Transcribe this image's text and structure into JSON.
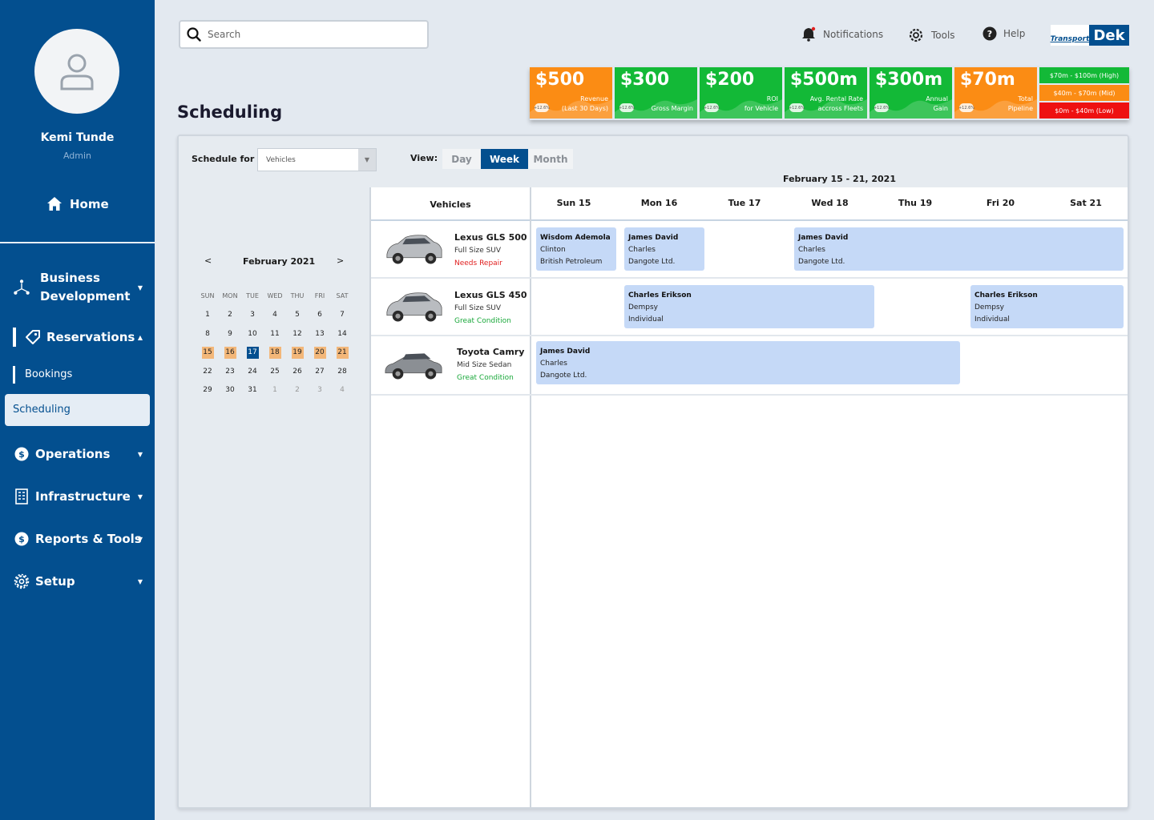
{
  "user": {
    "name": "Kemi Tunde",
    "role": "Admin"
  },
  "sidebar": {
    "home": "Home",
    "business_dev": [
      "Business",
      "Development"
    ],
    "reservations": "Reservations",
    "bookings": "Bookings",
    "scheduling": "Scheduling",
    "operations": "Operations",
    "infrastructure": "Infrastructure",
    "reports": "Reports & Tools",
    "setup": "Setup"
  },
  "topbar": {
    "search_placeholder": "Search",
    "notifications": "Notifications",
    "tools": "Tools",
    "help": "Help",
    "logo_left": "Transport",
    "logo_right": "Dek"
  },
  "page_title": "Scheduling",
  "kpis": [
    {
      "value": "$500",
      "label1": "Revenue",
      "label2": "(Last 30 Days)",
      "chip": "+12.6%",
      "color": "#fb8c14"
    },
    {
      "value": "$300",
      "label1": "",
      "label2": "Gross Margin",
      "chip": "+12.6%",
      "color": "#13b937"
    },
    {
      "value": "$200",
      "label1": "ROI",
      "label2": "for Vehicle",
      "chip": "+12.6%",
      "color": "#13b937"
    },
    {
      "value": "$500m",
      "label1": "Avg. Rental Rate",
      "label2": "accross Fleets",
      "chip": "+12.6%",
      "color": "#13b937"
    },
    {
      "value": "$300m",
      "label1": "Annual",
      "label2": "Gain",
      "chip": "+12.6%",
      "color": "#13b937"
    },
    {
      "value": "$70m",
      "label1": "Total",
      "label2": "Pipeline",
      "chip": "+12.6%",
      "color": "#fb8c14"
    }
  ],
  "pipeline": [
    {
      "text": "$70m - $100m (High)",
      "color": "#13b937"
    },
    {
      "text": "$40m - $70m (Mid)",
      "color": "#fb8c14"
    },
    {
      "text": "$0m - $40m (Low)",
      "color": "#ee1111"
    }
  ],
  "schedule": {
    "schedule_for_label": "Schedule for",
    "schedule_for_value": "Vehicles",
    "view_label": "View:",
    "views": [
      "Day",
      "Week",
      "Month"
    ],
    "active_view": "Week",
    "range": "February 15 - 21, 2021"
  },
  "mini_calendar": {
    "prev": "<",
    "next": ">",
    "title": "February 2021",
    "dow": [
      "SUN",
      "MON",
      "TUE",
      "WED",
      "THU",
      "FRI",
      "SAT"
    ],
    "weeks": [
      [
        "1",
        "2",
        "3",
        "4",
        "5",
        "6",
        "7"
      ],
      [
        "8",
        "9",
        "10",
        "11",
        "12",
        "13",
        "14"
      ],
      [
        "15",
        "16",
        "17",
        "18",
        "19",
        "20",
        "21"
      ],
      [
        "22",
        "23",
        "24",
        "25",
        "26",
        "27",
        "28"
      ],
      [
        "29",
        "30",
        "31",
        "1",
        "2",
        "3",
        "4"
      ]
    ],
    "highlighted_week": 2,
    "selected_day": "17"
  },
  "grid": {
    "vehicles_header": "Vehicles",
    "days": [
      "Sun 15",
      "Mon 16",
      "Tue 17",
      "Wed 18",
      "Thu 19",
      "Fri 20",
      "Sat 21"
    ]
  },
  "vehicles": [
    {
      "name": "Lexus GLS 500",
      "type": "Full Size SUV",
      "condition": "Needs Repair",
      "condition_color": "#e02020",
      "events": [
        {
          "name": "Wisdom Ademola",
          "line2": "Clinton",
          "line3": "British Petroleum"
        },
        {
          "name": "James David",
          "line2": "Charles",
          "line3": "Dangote Ltd."
        },
        {
          "name": "James David",
          "line2": "Charles",
          "line3": "Dangote Ltd."
        }
      ]
    },
    {
      "name": "Lexus GLS 450",
      "type": "Full Size SUV",
      "condition": "Great Condition",
      "condition_color": "#19a83a",
      "events": [
        {
          "name": "Charles Erikson",
          "line2": "Dempsy",
          "line3": "Individual"
        },
        {
          "name": "Charles Erikson",
          "line2": "Dempsy",
          "line3": "Individual"
        }
      ]
    },
    {
      "name": "Toyota Camry",
      "type": "Mid Size Sedan",
      "condition": "Great Condition",
      "condition_color": "#19a83a",
      "events": [
        {
          "name": "James David",
          "line2": "Charles",
          "line3": "Dangote Ltd."
        }
      ]
    }
  ]
}
